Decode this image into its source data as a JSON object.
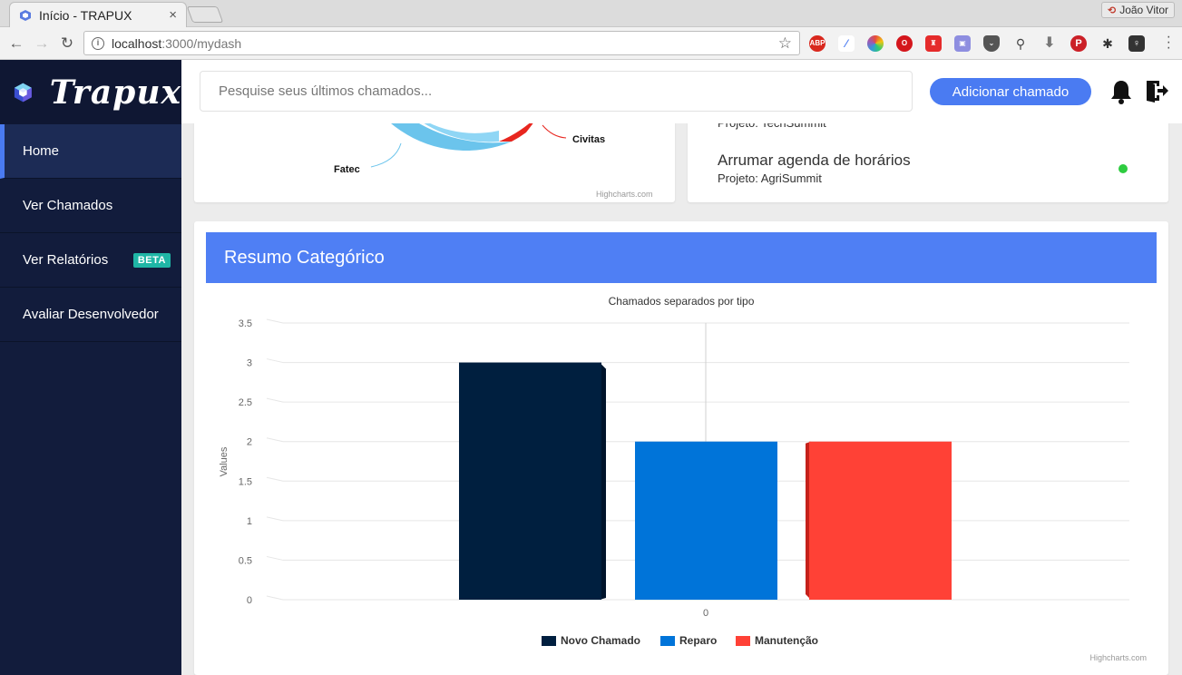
{
  "browser": {
    "tab_title": "Início - TRAPUX",
    "tab_close": "×",
    "profile_name": "João Vitor",
    "url_host": "localhost",
    "url_path": ":3000/mydash"
  },
  "brand": {
    "name": "Trapux"
  },
  "sidebar": {
    "items": [
      {
        "label": "Home",
        "active": true
      },
      {
        "label": "Ver Chamados"
      },
      {
        "label": "Ver Relatórios",
        "badge": "BETA"
      },
      {
        "label": "Avaliar Desenvolvedor"
      }
    ]
  },
  "topbar": {
    "search_placeholder": "Pesquise seus últimos chamados...",
    "add_button": "Adicionar chamado"
  },
  "pie_card": {
    "labels": [
      "Civitas",
      "Fatec"
    ],
    "credit": "Highcharts.com"
  },
  "list_card": {
    "items": [
      {
        "title": "",
        "project": "Projeto: TechSummit"
      },
      {
        "title": "Arrumar agenda de horários",
        "project": "Projeto: AgriSummit",
        "status_color": "#2ecc40"
      }
    ]
  },
  "chart_card": {
    "header": "Resumo Categórico"
  },
  "chart_data": {
    "type": "bar",
    "title": "Chamados separados por tipo",
    "xlabel": "",
    "ylabel": "Values",
    "categories": [
      "0"
    ],
    "ylim": [
      0,
      3.5
    ],
    "yticks": [
      0,
      0.5,
      1,
      1.5,
      2,
      2.5,
      3,
      3.5
    ],
    "series": [
      {
        "name": "Novo Chamado",
        "values": [
          3
        ],
        "color": "#001f3f"
      },
      {
        "name": "Reparo",
        "values": [
          2
        ],
        "color": "#0074d9"
      },
      {
        "name": "Manutenção",
        "values": [
          2
        ],
        "color": "#ff4136"
      }
    ],
    "legend_position": "bottom",
    "credit": "Highcharts.com"
  }
}
